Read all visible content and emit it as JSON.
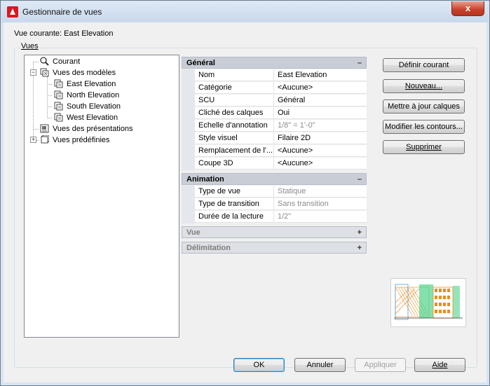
{
  "window": {
    "title": "Gestionnaire de vues",
    "close_label": "x",
    "icon": "autocad-a-icon"
  },
  "current_view": "Vue courante: East Elevation",
  "group_label": "Vues",
  "tree": {
    "items": [
      {
        "label": "Courant",
        "icon": "magnifier-icon"
      },
      {
        "label": "Vues des modèles",
        "icon": "model-views-icon"
      },
      {
        "label": "East Elevation",
        "icon": "view-icon"
      },
      {
        "label": "North Elevation",
        "icon": "view-icon"
      },
      {
        "label": "South Elevation",
        "icon": "view-icon"
      },
      {
        "label": "West Elevation",
        "icon": "view-icon"
      },
      {
        "label": "Vues des présentations",
        "icon": "layout-views-icon"
      },
      {
        "label": "Vues prédéfinies",
        "icon": "preset-views-icon"
      }
    ]
  },
  "properties": {
    "general": {
      "title": "Général",
      "toggle": "–",
      "rows": [
        {
          "name": "Nom",
          "value": "East Elevation"
        },
        {
          "name": "Catégorie",
          "value": "<Aucune>"
        },
        {
          "name": "SCU",
          "value": "Général"
        },
        {
          "name": "Cliché des calques",
          "value": "Oui"
        },
        {
          "name": "Echelle d'annotation",
          "value": "1/8\" = 1'-0\""
        },
        {
          "name": "Style visuel",
          "value": "Filaire 2D"
        },
        {
          "name": "Remplacement de l'...",
          "value": "<Aucune>"
        },
        {
          "name": "Coupe 3D",
          "value": "<Aucune>"
        }
      ]
    },
    "animation": {
      "title": "Animation",
      "toggle": "–",
      "rows": [
        {
          "name": "Type de vue",
          "value": "Statique"
        },
        {
          "name": "Type de transition",
          "value": "Sans transition"
        },
        {
          "name": "Durée de la lecture",
          "value": "1/2\""
        }
      ]
    },
    "view": {
      "title": "Vue",
      "toggle": "+"
    },
    "delimitation": {
      "title": "Délimitation",
      "toggle": "+"
    }
  },
  "side_buttons": {
    "set_current": "Définir courant",
    "new": "Nouveau...",
    "update_layers": "Mettre à jour calques",
    "edit_boundaries": "Modifier les contours...",
    "delete": "Supprimer"
  },
  "footer_buttons": {
    "ok": "OK",
    "cancel": "Annuler",
    "apply": "Appliquer",
    "help": "Aide"
  },
  "colors": {
    "preview_orange": "#f08a1e",
    "preview_green": "#4fd48a",
    "preview_blue": "#4a9fd8"
  }
}
